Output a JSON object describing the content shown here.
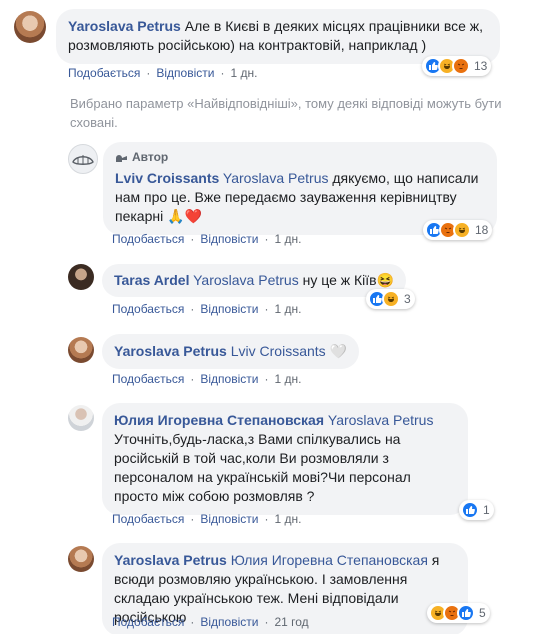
{
  "actions": {
    "like": "Подобається",
    "reply": "Відповісти",
    "sep": "·"
  },
  "author_badge": "Автор",
  "notice": "Вибрано параметр «Найвідповідніші», тому деякі відповіді можуть бути сховані.",
  "colors": {
    "link": "#385898",
    "bubble": "#f2f3f5",
    "like": "#1877f2",
    "haha": "#f7b125",
    "angry": "#e9710f",
    "love": "#f33e58"
  },
  "comments": [
    {
      "author": "Yaroslava Petrus",
      "text": "Але в Києві в деяких місцях працівники все ж, розмовляють російською) на контрактовій, наприклад )",
      "time": "1 дн.",
      "reactions": [
        "like-icon",
        "haha-icon",
        "angry-icon"
      ],
      "reaction_count": "13"
    },
    {
      "author": "Lviv Croissants",
      "mention": "Yaroslava Petrus",
      "text": "дякуємо, що написали нам про це. Вже передаємо зауваження керівництву пекарні 🙏❤️",
      "time": "1 дн.",
      "reactions": [
        "like-icon",
        "angry-icon",
        "haha-icon"
      ],
      "reaction_count": "18"
    },
    {
      "author": "Taras Ardel",
      "mention": "Yaroslava Petrus",
      "text": "ну це ж Кіїв😆",
      "time": "1 дн.",
      "reactions": [
        "like-icon",
        "haha-icon"
      ],
      "reaction_count": "3"
    },
    {
      "author": "Yaroslava Petrus",
      "mention": "Lviv Croissants",
      "text": "🤍",
      "time": "1 дн."
    },
    {
      "author": "Юлия Игоревна Степановская",
      "mention": "Yaroslava Petrus",
      "text": "Уточніть,будь-ласка,з Вами спілкувались на російській в той час,коли Ви розмовляли з персоналом на українській мові?Чи персонал просто між собою розмовляв ?",
      "time": "1 дн.",
      "reactions": [
        "like-icon"
      ],
      "reaction_count": "1"
    },
    {
      "author": "Yaroslava Petrus",
      "mention": "Юлия Игоревна Степановская",
      "text": "я всюди розмовляю українською. І замовлення складаю українською теж. Мені відповідали російською",
      "time": "21 год",
      "reactions": [
        "haha-icon",
        "angry-icon",
        "like-icon"
      ],
      "reaction_count": "5"
    }
  ]
}
